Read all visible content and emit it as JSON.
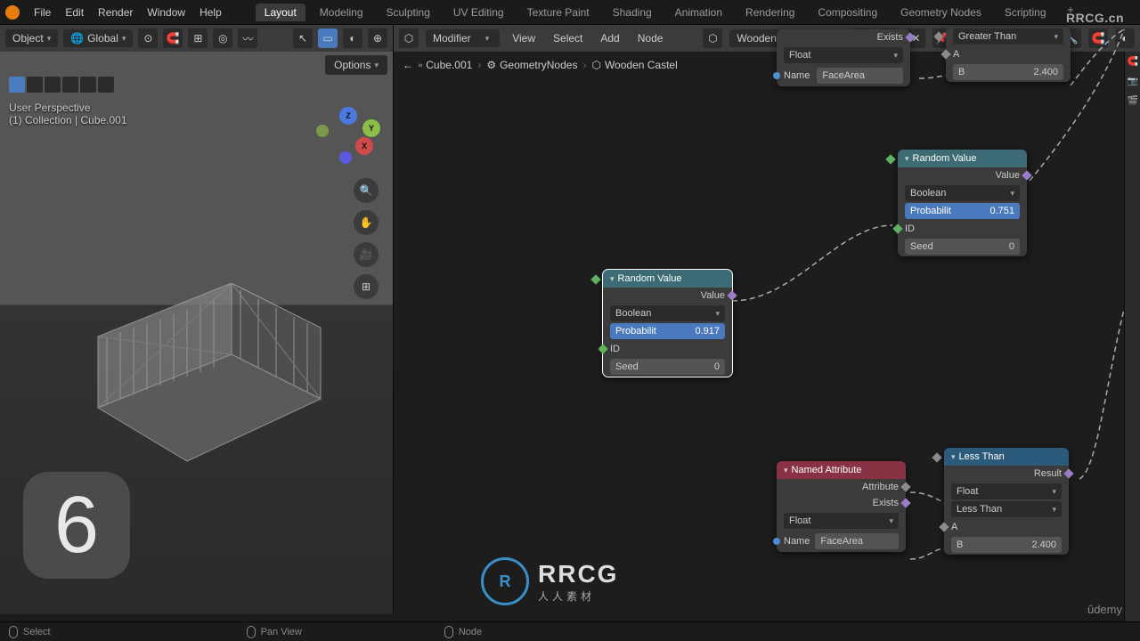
{
  "menu": {
    "file": "File",
    "edit": "Edit",
    "render": "Render",
    "window": "Window",
    "help": "Help"
  },
  "tabs": [
    "Layout",
    "Modeling",
    "Sculpting",
    "UV Editing",
    "Texture Paint",
    "Shading",
    "Animation",
    "Rendering",
    "Compositing",
    "Geometry Nodes",
    "Scripting"
  ],
  "tabs_active": 0,
  "toolbar": {
    "mode": "Object",
    "orient": "Global"
  },
  "viewport": {
    "label1": "User Perspective",
    "label2": "(1) Collection | Cube.001",
    "options": "Options",
    "big_char": "6"
  },
  "node_editor": {
    "menu": {
      "view": "View",
      "select": "Select",
      "add": "Add",
      "node": "Node"
    },
    "modifier": "Modifier",
    "tree": "Wooden Castel",
    "breadcrumb": [
      "Cube.001",
      "GeometryNodes",
      "Wooden Castel"
    ]
  },
  "nodes": {
    "named1": {
      "exists": "Exists",
      "type": "Float",
      "name_lbl": "Name",
      "name_val": "FaceArea"
    },
    "gt": {
      "title": "Greater Than",
      "a": "A",
      "b_lbl": "B",
      "b_val": "2.400"
    },
    "rv1": {
      "title": "Random Value",
      "value": "Value",
      "type": "Boolean",
      "prob_lbl": "Probabilit",
      "prob_val": "0.751",
      "id": "ID",
      "seed_lbl": "Seed",
      "seed_val": "0"
    },
    "rv2": {
      "title": "Random Value",
      "value": "Value",
      "type": "Boolean",
      "prob_lbl": "Probabilit",
      "prob_val": "0.917",
      "id": "ID",
      "seed_lbl": "Seed",
      "seed_val": "0"
    },
    "named2": {
      "title": "Named Attribute",
      "attr": "Attribute",
      "exists": "Exists",
      "type": "Float",
      "name_lbl": "Name",
      "name_val": "FaceArea"
    },
    "lt": {
      "title": "Less Than",
      "result": "Result",
      "type": "Float",
      "op": "Less Than",
      "a": "A",
      "b_lbl": "B",
      "b_val": "2.400"
    }
  },
  "status": {
    "select": "Select",
    "pan": "Pan View",
    "node": "Node"
  },
  "watermarks": {
    "top": "RRCG.cn",
    "center_big": "RRCG",
    "center_small": "人人素材",
    "bottom": "ûdemy"
  }
}
